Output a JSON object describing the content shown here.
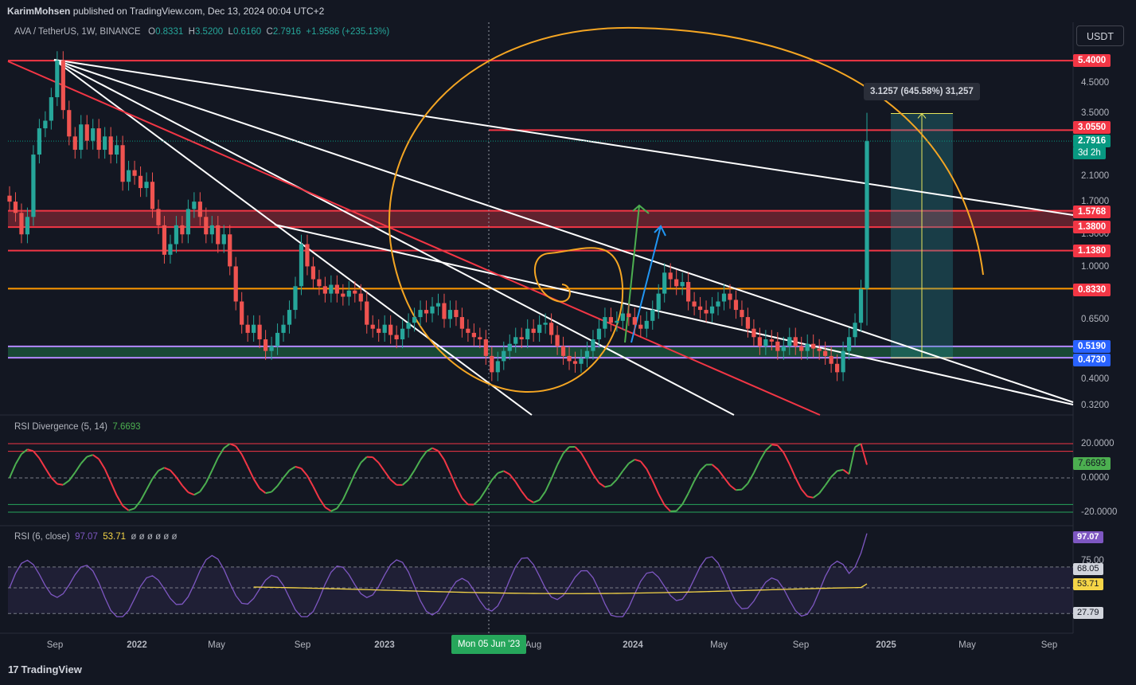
{
  "header": {
    "author": "KarimMohsen",
    "published_text": "published on TradingView.com, Dec 13, 2024 00:04 UTC+2"
  },
  "currency_button": "USDT",
  "legend": {
    "symbol": "AVA / TetherUS, 1W, BINANCE",
    "o_label": "O",
    "o": "0.8331",
    "h_label": "H",
    "h": "3.5200",
    "l_label": "L",
    "l": "0.6160",
    "c_label": "C",
    "c": "2.7916",
    "change": "+1.9586 (+235.13%)"
  },
  "measure_label": "3.1257 (645.58%) 31,257",
  "price_badges": [
    {
      "text": "5.4000",
      "color": "#f23645"
    },
    {
      "text": "3.0550",
      "color": "#f23645"
    },
    {
      "text": "2.7916",
      "color": "#089981"
    },
    {
      "text": "3d 2h",
      "color": "#089981"
    },
    {
      "text": "1.5768",
      "color": "#f23645"
    },
    {
      "text": "1.3800",
      "color": "#f23645"
    },
    {
      "text": "1.1380",
      "color": "#f23645"
    },
    {
      "text": "0.8330",
      "color": "#f23645"
    },
    {
      "text": "0.5190",
      "color": "#2962ff"
    },
    {
      "text": "0.4730",
      "color": "#2962ff"
    }
  ],
  "price_axis": [
    "4.5000",
    "3.5000",
    "2.1000",
    "1.7000",
    "1.3000",
    "1.0000",
    "0.6500",
    "0.4000",
    "0.3200"
  ],
  "rsi_div": {
    "title": "RSI Divergence (5, 14)",
    "value": "7.6693",
    "axis": [
      "20.0000",
      "0.0000",
      "-20.0000"
    ]
  },
  "rsi": {
    "title": "RSI (6, close)",
    "value1": "97.07",
    "value2": "53.71",
    "extras": "ø ø ø ø ø ø",
    "badges": [
      "97.07",
      "68.05",
      "53.71",
      "27.79"
    ],
    "axis": [
      "75.00"
    ]
  },
  "time_axis": [
    "Sep",
    "2022",
    "May",
    "Sep",
    "2023",
    "Aug",
    "2024",
    "May",
    "Sep",
    "2025",
    "May",
    "Sep"
  ],
  "crosshair_date": "Mon 05 Jun '23",
  "footer": "TradingView",
  "colors": {
    "up": "#26a69a",
    "down": "#ef5350",
    "bg": "#131722",
    "orange": "#f5a623",
    "red_level": "#f23645"
  },
  "chart_data": {
    "type": "candlestick",
    "symbol": "AVA / TetherUS",
    "timeframe": "1W",
    "exchange": "BINANCE",
    "price_scale": "log",
    "last": {
      "open": 0.8331,
      "high": 3.52,
      "low": 0.616,
      "close": 2.7916
    },
    "horizontal_levels": [
      5.4,
      3.055,
      1.5768,
      1.38,
      1.138,
      0.833,
      0.519,
      0.473
    ],
    "target_box": {
      "low": 0.473,
      "high": 3.5,
      "change": "3.1257 (645.58%)"
    },
    "x_range": [
      "2021-08",
      "2025-09"
    ],
    "approx_weekly_closes": [
      1.7,
      1.55,
      1.3,
      1.5,
      2.5,
      3.1,
      3.3,
      4.0,
      5.4,
      3.6,
      2.9,
      2.6,
      3.2,
      2.8,
      3.1,
      2.6,
      2.9,
      2.5,
      2.7,
      2.0,
      2.2,
      2.1,
      1.9,
      2.0,
      1.6,
      1.4,
      1.1,
      1.2,
      1.4,
      1.3,
      1.6,
      1.7,
      1.5,
      1.3,
      1.4,
      1.2,
      1.3,
      1.0,
      0.75,
      0.62,
      0.58,
      0.62,
      0.55,
      0.5,
      0.52,
      0.58,
      0.62,
      0.7,
      0.85,
      1.2,
      1.0,
      0.9,
      0.85,
      0.8,
      0.86,
      0.8,
      0.78,
      0.82,
      0.8,
      0.75,
      0.62,
      0.6,
      0.58,
      0.62,
      0.57,
      0.55,
      0.6,
      0.63,
      0.66,
      0.7,
      0.68,
      0.72,
      0.74,
      0.65,
      0.7,
      0.66,
      0.6,
      0.58,
      0.56,
      0.55,
      0.48,
      0.42,
      0.46,
      0.5,
      0.53,
      0.56,
      0.55,
      0.6,
      0.58,
      0.62,
      0.63,
      0.57,
      0.52,
      0.48,
      0.46,
      0.45,
      0.47,
      0.5,
      0.55,
      0.6,
      0.66,
      0.63,
      0.64,
      0.68,
      0.66,
      0.62,
      0.6,
      0.64,
      0.7,
      0.8,
      0.95,
      0.9,
      0.85,
      0.88,
      0.75,
      0.72,
      0.7,
      0.68,
      0.72,
      0.75,
      0.8,
      0.76,
      0.7,
      0.66,
      0.6,
      0.56,
      0.52,
      0.55,
      0.54,
      0.5,
      0.52,
      0.56,
      0.52,
      0.5,
      0.53,
      0.51,
      0.5,
      0.48,
      0.45,
      0.42,
      0.5,
      0.56,
      0.63,
      0.83,
      2.79
    ],
    "rsi_divergence": {
      "upper": 20,
      "lower": -20,
      "last": 7.6693
    },
    "rsi": {
      "upper": 68.05,
      "lower": 27.79,
      "last": 97.07,
      "ma": 53.71
    }
  }
}
